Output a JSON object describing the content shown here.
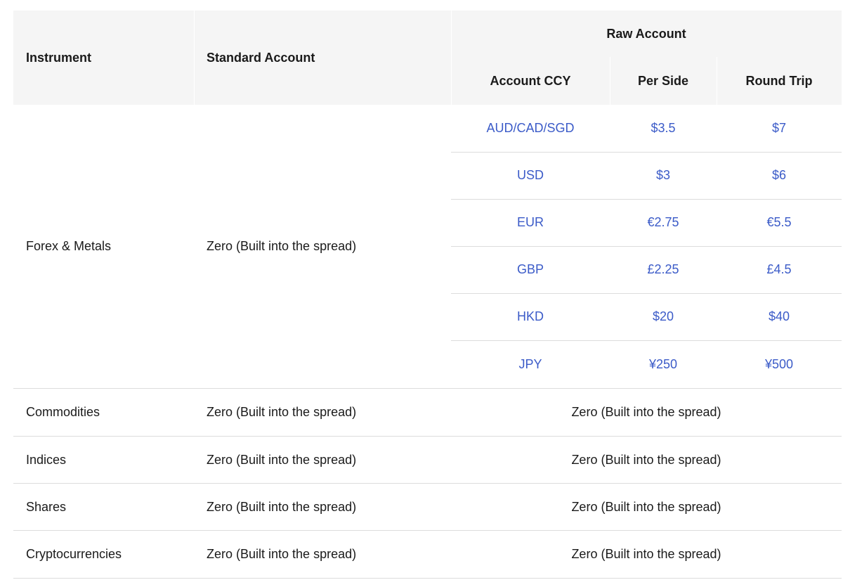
{
  "headers": {
    "instrument": "Instrument",
    "standard": "Standard Account",
    "raw": "Raw Account",
    "ccy": "Account CCY",
    "per_side": "Per Side",
    "round_trip": "Round Trip"
  },
  "forex": {
    "instrument": "Forex & Metals",
    "standard": "Zero (Built into the spread)",
    "rows": [
      {
        "ccy": "AUD/CAD/SGD",
        "per_side": "$3.5",
        "round_trip": "$7"
      },
      {
        "ccy": "USD",
        "per_side": "$3",
        "round_trip": "$6"
      },
      {
        "ccy": "EUR",
        "per_side": "€2.75",
        "round_trip": "€5.5"
      },
      {
        "ccy": "GBP",
        "per_side": "£2.25",
        "round_trip": "£4.5"
      },
      {
        "ccy": "HKD",
        "per_side": "$20",
        "round_trip": "$40"
      },
      {
        "ccy": "JPY",
        "per_side": "¥250",
        "round_trip": "¥500"
      }
    ]
  },
  "others": [
    {
      "instrument": "Commodities",
      "standard": "Zero (Built into the spread)",
      "raw": "Zero (Built into the spread)"
    },
    {
      "instrument": "Indices",
      "standard": "Zero (Built into the spread)",
      "raw": "Zero (Built into the spread)"
    },
    {
      "instrument": "Shares",
      "standard": "Zero (Built into the spread)",
      "raw": "Zero (Built into the spread)"
    },
    {
      "instrument": "Cryptocurrencies",
      "standard": "Zero (Built into the spread)",
      "raw": "Zero (Built into the spread)"
    }
  ],
  "colors": {
    "header_bg": "#f5f5f5",
    "link_blue": "#3b5bc8",
    "divider": "#dcdcdc"
  }
}
